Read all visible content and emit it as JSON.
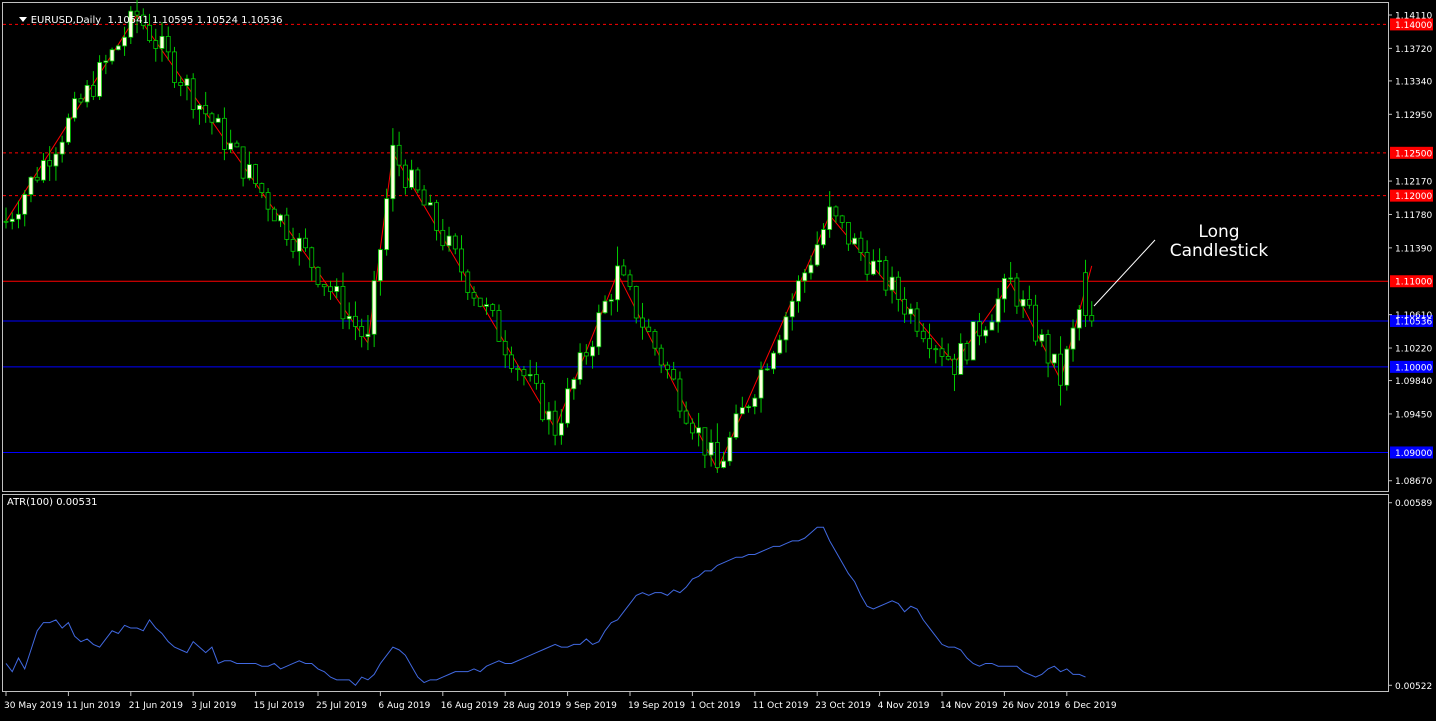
{
  "header": {
    "title": "EURUSD,Daily  1.10541 1.10595 1.10524 1.10536",
    "menu_icon": "triangle-down-icon"
  },
  "indicator": {
    "label": "ATR(100) 0.00531"
  },
  "annotation": {
    "line1": "Long",
    "line2": "Candlestick"
  },
  "colors": {
    "background": "#000000",
    "bull_candle": "#ffffe0",
    "wick": "#00cc00",
    "zigzag": "#ff0000",
    "red_level": "#ff0000",
    "blue_level": "#0000ff",
    "atr_line": "#4169e1",
    "axis": "#c0c0c0"
  },
  "chart_data": [
    {
      "type": "candlestick",
      "symbol": "EURUSD",
      "timeframe": "Daily",
      "ylim": [
        1.0855,
        1.1425
      ],
      "y_ticks": [
        "1.14110",
        "1.13720",
        "1.13340",
        "1.12950",
        "1.12170",
        "1.11780",
        "1.11390",
        "1.10610",
        "1.10220",
        "1.09840",
        "1.09450",
        "1.08670"
      ],
      "x_ticks": [
        "30 May 2019",
        "11 Jun 2019",
        "21 Jun 2019",
        "3 Jul 2019",
        "15 Jul 2019",
        "25 Jul 2019",
        "6 Aug 2019",
        "16 Aug 2019",
        "28 Aug 2019",
        "9 Sep 2019",
        "19 Sep 2019",
        "1 Oct 2019",
        "11 Oct 2019",
        "23 Oct 2019",
        "4 Nov 2019",
        "14 Nov 2019",
        "26 Nov 2019",
        "6 Dec 2019"
      ],
      "price_levels": [
        {
          "price": 1.14,
          "label": "1.14000",
          "color": "red",
          "style": "dashed"
        },
        {
          "price": 1.125,
          "label": "1.12500",
          "color": "red",
          "style": "dashed"
        },
        {
          "price": 1.12,
          "label": "1.12000",
          "color": "red",
          "style": "dashed"
        },
        {
          "price": 1.11,
          "label": "1.11000",
          "color": "red",
          "style": "solid"
        },
        {
          "price": 1.10536,
          "label": "1.10536",
          "color": "blue",
          "style": "solid"
        },
        {
          "price": 1.1,
          "label": "1.10000",
          "color": "blue",
          "style": "solid"
        },
        {
          "price": 1.09,
          "label": "1.09000",
          "color": "blue",
          "style": "solid"
        }
      ],
      "zigzag": [
        {
          "i": 0,
          "p": 1.117
        },
        {
          "i": 21,
          "p": 1.1411
        },
        {
          "i": 58,
          "p": 1.1028
        },
        {
          "i": 62,
          "p": 1.125
        },
        {
          "i": 88,
          "p": 1.0928
        },
        {
          "i": 98,
          "p": 1.1109
        },
        {
          "i": 114,
          "p": 1.088
        },
        {
          "i": 132,
          "p": 1.1177
        },
        {
          "i": 152,
          "p": 1.1004
        },
        {
          "i": 161,
          "p": 1.1098
        },
        {
          "i": 169,
          "p": 1.0985
        },
        {
          "i": 174,
          "p": 1.1118
        }
      ]
    },
    {
      "type": "line",
      "name": "ATR(100)",
      "ylim": [
        0.00521,
        0.0059
      ],
      "y_ticks": [
        "0.00589",
        "0.00522"
      ],
      "values": [
        0.0053,
        0.00527,
        0.00532,
        0.00528,
        0.00535,
        0.00542,
        0.00545,
        0.00545,
        0.00546,
        0.00543,
        0.00545,
        0.0054,
        0.00538,
        0.00539,
        0.00537,
        0.00536,
        0.00539,
        0.00542,
        0.00541,
        0.00544,
        0.00543,
        0.00543,
        0.00542,
        0.00546,
        0.00543,
        0.00541,
        0.00538,
        0.00536,
        0.00535,
        0.00534,
        0.00538,
        0.00536,
        0.00534,
        0.00536,
        0.0053,
        0.00531,
        0.00531,
        0.0053,
        0.0053,
        0.0053,
        0.0053,
        0.00529,
        0.00529,
        0.0053,
        0.00528,
        0.00529,
        0.0053,
        0.00531,
        0.0053,
        0.0053,
        0.00528,
        0.00527,
        0.00525,
        0.00524,
        0.00524,
        0.00524,
        0.00522,
        0.00525,
        0.00524,
        0.00526,
        0.0053,
        0.00533,
        0.00536,
        0.00535,
        0.00533,
        0.00529,
        0.00525,
        0.00523,
        0.00524,
        0.00524,
        0.00525,
        0.00526,
        0.00527,
        0.00527,
        0.00527,
        0.00528,
        0.00527,
        0.00529,
        0.0053,
        0.00531,
        0.0053,
        0.0053,
        0.00531,
        0.00532,
        0.00533,
        0.00534,
        0.00535,
        0.00536,
        0.00537,
        0.00536,
        0.00536,
        0.00537,
        0.00537,
        0.00539,
        0.00537,
        0.00538,
        0.00542,
        0.00545,
        0.00546,
        0.00549,
        0.00552,
        0.00555,
        0.00556,
        0.00555,
        0.00556,
        0.00556,
        0.00555,
        0.00557,
        0.00556,
        0.00558,
        0.00561,
        0.00562,
        0.00564,
        0.00564,
        0.00566,
        0.00567,
        0.00568,
        0.00569,
        0.00569,
        0.0057,
        0.0057,
        0.00571,
        0.00572,
        0.00573,
        0.00573,
        0.00574,
        0.00575,
        0.00575,
        0.00576,
        0.00578,
        0.0058,
        0.0058,
        0.00575,
        0.00571,
        0.00567,
        0.00563,
        0.0056,
        0.00555,
        0.00551,
        0.0055,
        0.00551,
        0.00552,
        0.00553,
        0.00552,
        0.00549,
        0.00551,
        0.0055,
        0.00546,
        0.00543,
        0.0054,
        0.00537,
        0.00536,
        0.00536,
        0.00535,
        0.00532,
        0.0053,
        0.00529,
        0.0053,
        0.0053,
        0.00529,
        0.00529,
        0.00529,
        0.00529,
        0.00527,
        0.00526,
        0.00525,
        0.00526,
        0.00528,
        0.00529,
        0.00527,
        0.00528,
        0.00526,
        0.00526,
        0.00525
      ]
    }
  ]
}
